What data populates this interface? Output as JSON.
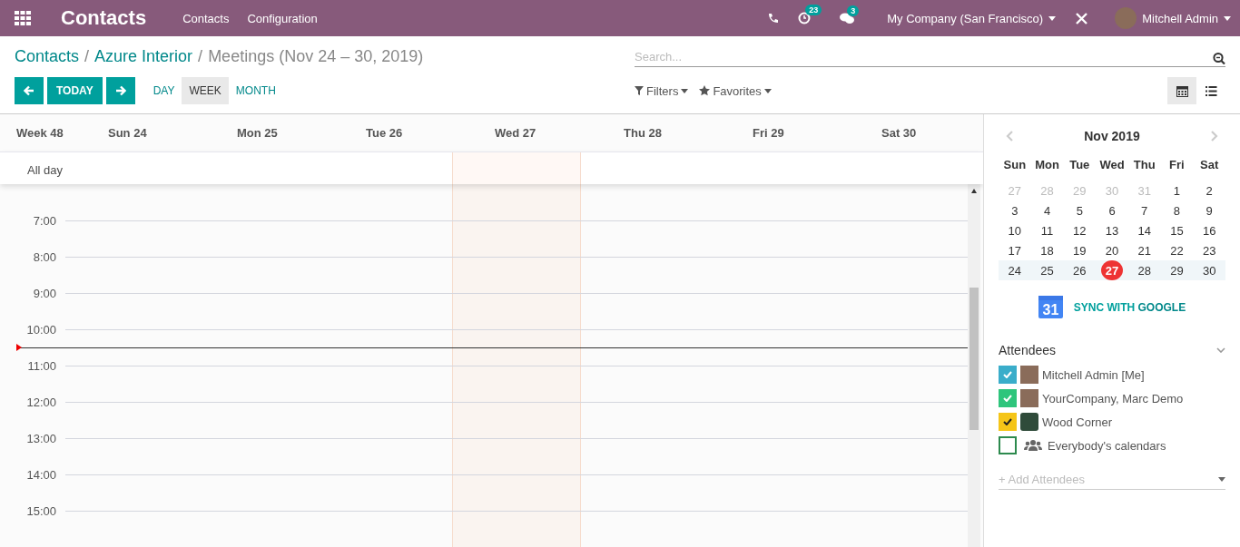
{
  "navbar": {
    "app_title": "Contacts",
    "menu": [
      "Contacts",
      "Configuration"
    ],
    "activity_count": "23",
    "message_count": "3",
    "company": "My Company (San Francisco)",
    "user": "Mitchell Admin"
  },
  "breadcrumbs": [
    {
      "label": "Contacts",
      "link": true
    },
    {
      "separator": "/",
      "label": "Azure Interior",
      "link": true
    },
    {
      "separator": "/",
      "label": "Meetings (Nov 24 – 30, 2019)",
      "link": false
    }
  ],
  "search": {
    "placeholder": "Search..."
  },
  "nav_buttons": {
    "today": "TODAY"
  },
  "scales": [
    {
      "label": "DAY",
      "selected": false
    },
    {
      "label": "WEEK",
      "selected": true
    },
    {
      "label": "MONTH",
      "selected": false
    }
  ],
  "filters": [
    "Filters",
    "Favorites"
  ],
  "views": [
    {
      "kind": "calendar",
      "selected": true
    },
    {
      "kind": "list",
      "selected": false
    }
  ],
  "week": {
    "label": "Week 48",
    "all_day": "All day",
    "days": [
      {
        "label": "Sun 24",
        "today": false
      },
      {
        "label": "Mon 25",
        "today": false
      },
      {
        "label": "Tue 26",
        "today": false
      },
      {
        "label": "Wed 27",
        "today": true
      },
      {
        "label": "Thu 28",
        "today": false
      },
      {
        "label": "Fri 29",
        "today": false
      },
      {
        "label": "Sat 30",
        "today": false
      }
    ],
    "hours": [
      "7:00",
      "8:00",
      "9:00",
      "10:00",
      "11:00",
      "12:00",
      "13:00",
      "14:00",
      "15:00"
    ]
  },
  "mini_calendar": {
    "title": "Nov 2019",
    "weekdays": [
      "Sun",
      "Mon",
      "Tue",
      "Wed",
      "Thu",
      "Fri",
      "Sat"
    ],
    "weeks": [
      {
        "selected": false,
        "days": [
          {
            "d": "27",
            "muted": true,
            "today": false
          },
          {
            "d": "28",
            "muted": true,
            "today": false
          },
          {
            "d": "29",
            "muted": true,
            "today": false
          },
          {
            "d": "30",
            "muted": true,
            "today": false
          },
          {
            "d": "31",
            "muted": true,
            "today": false
          },
          {
            "d": "1",
            "muted": false,
            "today": false
          },
          {
            "d": "2",
            "muted": false,
            "today": false
          }
        ]
      },
      {
        "selected": false,
        "days": [
          {
            "d": "3",
            "muted": false,
            "today": false
          },
          {
            "d": "4",
            "muted": false,
            "today": false
          },
          {
            "d": "5",
            "muted": false,
            "today": false
          },
          {
            "d": "6",
            "muted": false,
            "today": false
          },
          {
            "d": "7",
            "muted": false,
            "today": false
          },
          {
            "d": "8",
            "muted": false,
            "today": false
          },
          {
            "d": "9",
            "muted": false,
            "today": false
          }
        ]
      },
      {
        "selected": false,
        "days": [
          {
            "d": "10",
            "muted": false,
            "today": false
          },
          {
            "d": "11",
            "muted": false,
            "today": false
          },
          {
            "d": "12",
            "muted": false,
            "today": false
          },
          {
            "d": "13",
            "muted": false,
            "today": false
          },
          {
            "d": "14",
            "muted": false,
            "today": false
          },
          {
            "d": "15",
            "muted": false,
            "today": false
          },
          {
            "d": "16",
            "muted": false,
            "today": false
          }
        ]
      },
      {
        "selected": false,
        "days": [
          {
            "d": "17",
            "muted": false,
            "today": false
          },
          {
            "d": "18",
            "muted": false,
            "today": false
          },
          {
            "d": "19",
            "muted": false,
            "today": false
          },
          {
            "d": "20",
            "muted": false,
            "today": false
          },
          {
            "d": "21",
            "muted": false,
            "today": false
          },
          {
            "d": "22",
            "muted": false,
            "today": false
          },
          {
            "d": "23",
            "muted": false,
            "today": false
          }
        ]
      },
      {
        "selected": true,
        "days": [
          {
            "d": "24",
            "muted": false,
            "today": false
          },
          {
            "d": "25",
            "muted": false,
            "today": false
          },
          {
            "d": "26",
            "muted": false,
            "today": false
          },
          {
            "d": "27",
            "muted": false,
            "today": true
          },
          {
            "d": "28",
            "muted": false,
            "today": false
          },
          {
            "d": "29",
            "muted": false,
            "today": false
          },
          {
            "d": "30",
            "muted": false,
            "today": false
          }
        ]
      }
    ]
  },
  "sync": {
    "label_prefix": "SYNC WITH ",
    "label_brand": "GOOGLE",
    "icon_day": "31"
  },
  "attendees": {
    "title": "Attendees",
    "items": [
      {
        "name": "Mitchell Admin [Me]",
        "checked": true,
        "color": "#3aadca",
        "kind": "person"
      },
      {
        "name": "YourCompany, Marc Demo",
        "checked": true,
        "color": "#2ec57c",
        "kind": "person"
      },
      {
        "name": "Wood Corner",
        "checked": true,
        "color": "#f5c518",
        "kind": "company"
      },
      {
        "name": "Everybody's calendars",
        "checked": false,
        "color": "#2d8a4e",
        "kind": "group"
      }
    ],
    "add_placeholder": "+ Add Attendees"
  }
}
